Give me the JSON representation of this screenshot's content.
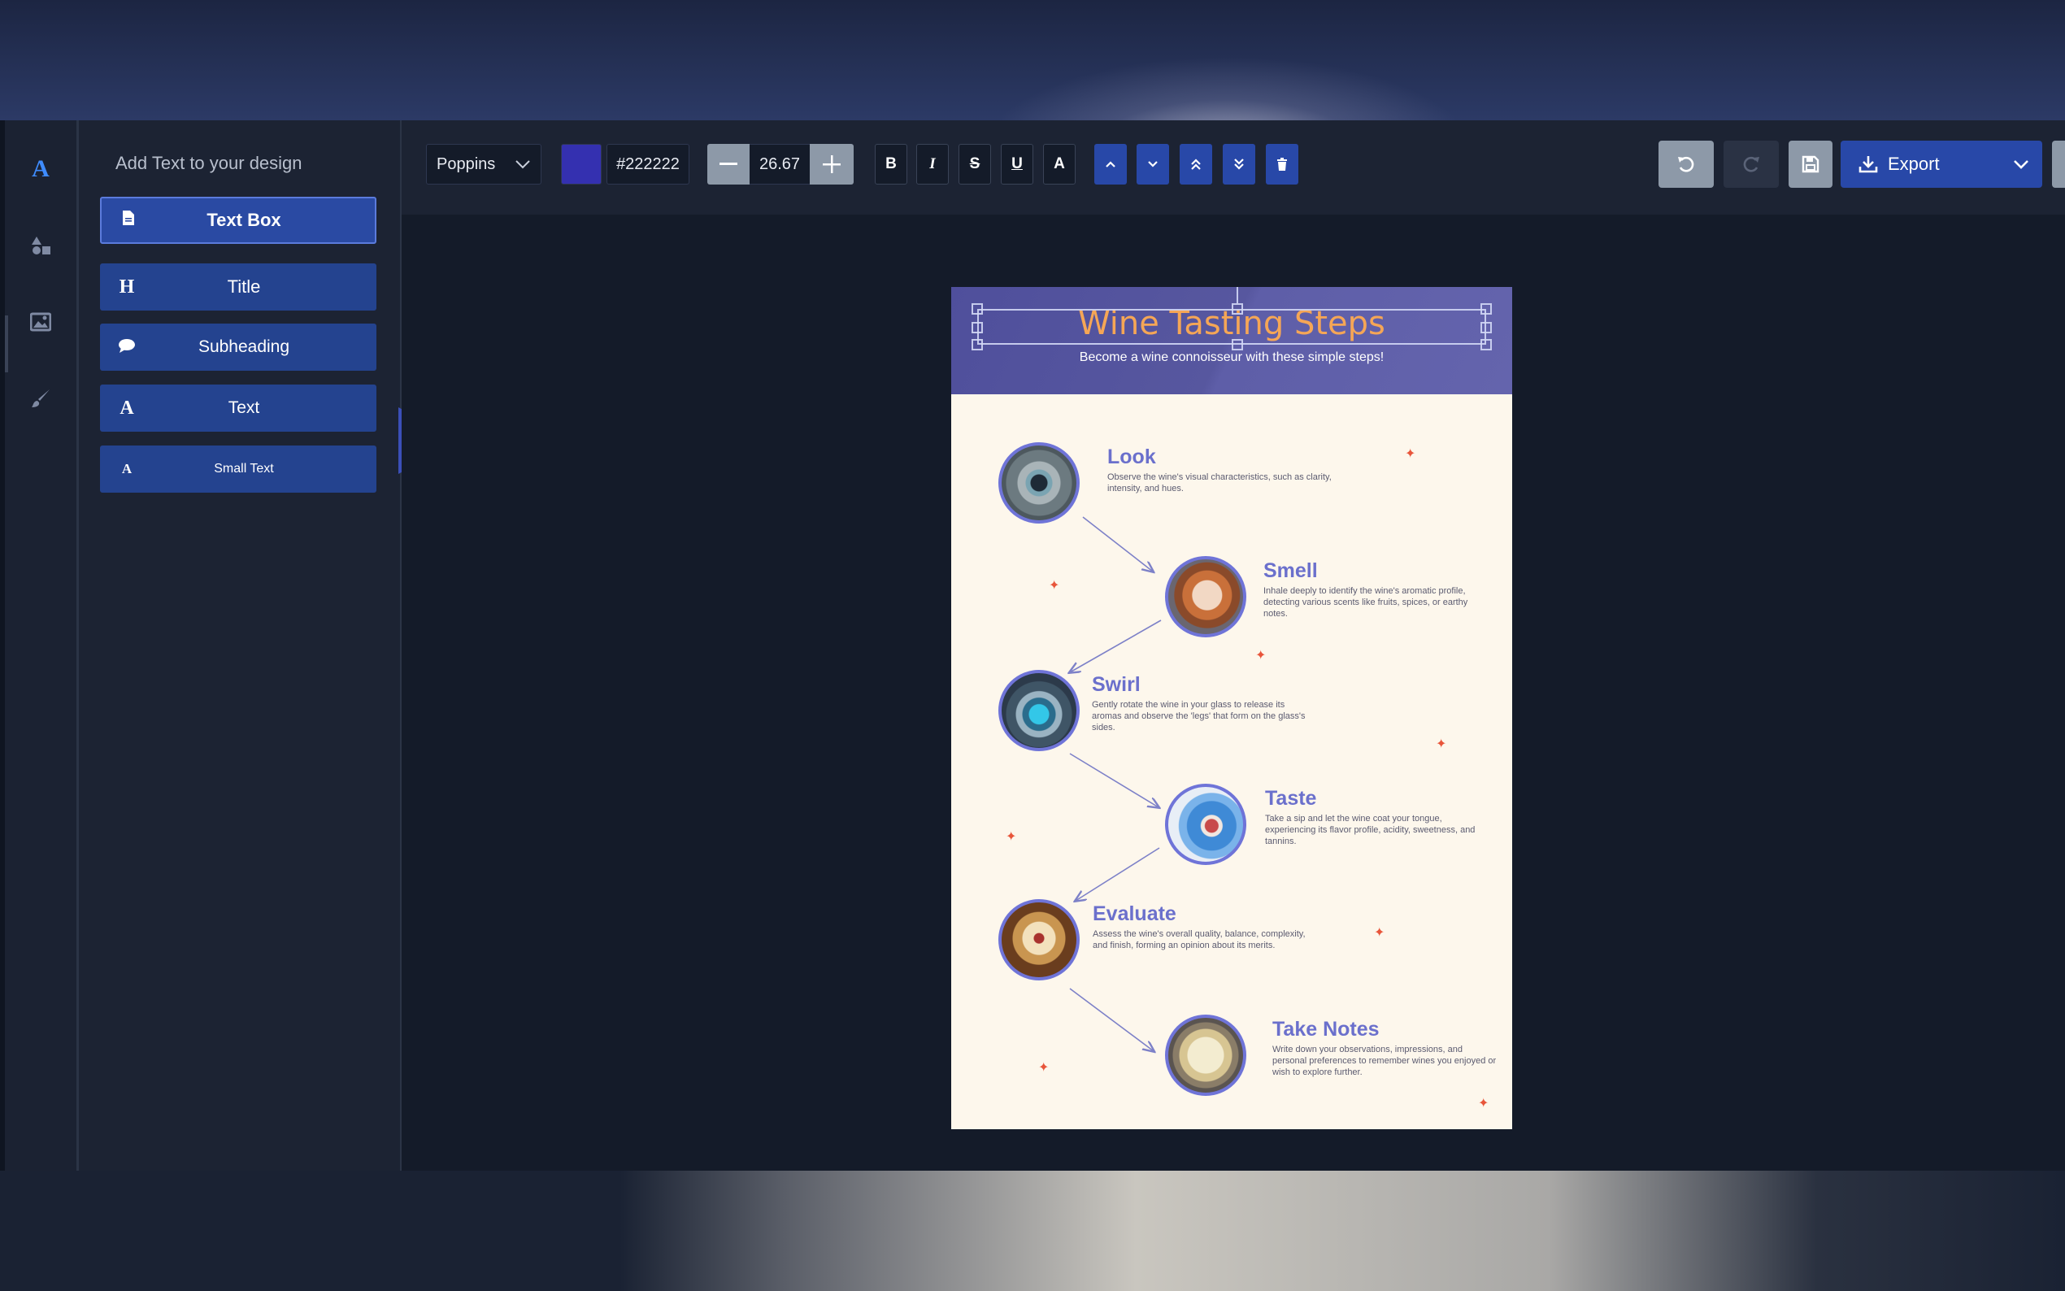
{
  "panel": {
    "title": "Add Text to your design",
    "buttons": [
      {
        "label": "Text Box",
        "icon": "document-icon"
      },
      {
        "label": "Title",
        "icon": "H"
      },
      {
        "label": "Subheading",
        "icon": "comment-icon"
      },
      {
        "label": "Text",
        "icon": "A"
      },
      {
        "label": "Small Text",
        "icon": "A"
      }
    ]
  },
  "toolbar": {
    "font": "Poppins",
    "color_hex": "#222222",
    "swatch_color": "#3430b0",
    "font_size": "26.67",
    "bold": "B",
    "italic": "I",
    "strike": "S",
    "underline": "U",
    "text_color": "A",
    "export_label": "Export"
  },
  "design": {
    "title": "Wine Tasting Steps",
    "subtitle": "Become a wine connoisseur with these simple steps!",
    "steps": [
      {
        "title": "Look",
        "desc": "Observe the wine's visual characteristics, such as clarity, intensity, and hues."
      },
      {
        "title": "Smell",
        "desc": "Inhale deeply to identify the wine's aromatic profile, detecting various scents like fruits, spices, or earthy notes."
      },
      {
        "title": "Swirl",
        "desc": "Gently rotate the wine in your glass to release its aromas and observe the 'legs' that form on the glass's sides."
      },
      {
        "title": "Taste",
        "desc": "Take a sip and let the wine coat your tongue, experiencing its flavor profile, acidity, sweetness, and tannins."
      },
      {
        "title": "Evaluate",
        "desc": "Assess the wine's overall quality, balance, complexity, and finish, forming an opinion about its merits."
      },
      {
        "title": "Take Notes",
        "desc": "Write down your observations, impressions, and personal preferences to remember wines you enjoyed or wish to explore further."
      }
    ]
  },
  "colors": {
    "accent": "#2848a8",
    "title_orange": "#f5a656",
    "step_purple": "#6b70cc",
    "header_purple": "#57579f"
  }
}
